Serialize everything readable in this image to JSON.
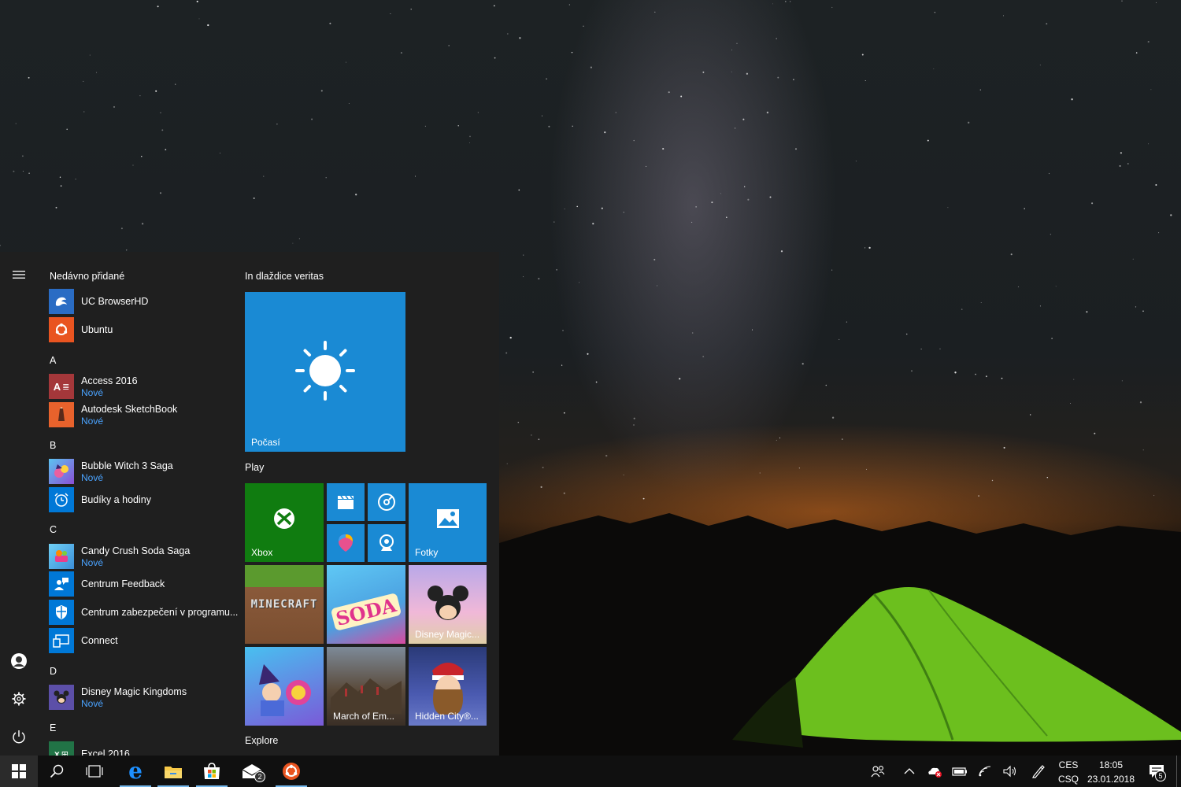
{
  "start_menu": {
    "menu_icon": "hamburger-icon",
    "recent_header": "Nedávno přidané",
    "recent": [
      {
        "name": "UC BrowserHD",
        "icon": "uc-browser-icon"
      },
      {
        "name": "Ubuntu",
        "icon": "ubuntu-icon"
      }
    ],
    "letters": {
      "a": "A",
      "b": "B",
      "c": "C",
      "d": "D",
      "e": "E"
    },
    "apps": [
      {
        "name": "Access 2016",
        "badge": "Nové",
        "icon": "access-icon"
      },
      {
        "name": "Autodesk SketchBook",
        "badge": "Nové",
        "icon": "sketchbook-icon"
      },
      {
        "name": "Bubble Witch 3 Saga",
        "badge": "Nové",
        "icon": "bubble-witch-icon"
      },
      {
        "name": "Budíky a hodiny",
        "icon": "alarm-clock-icon"
      },
      {
        "name": "Candy Crush Soda Saga",
        "badge": "Nové",
        "icon": "candy-crush-icon"
      },
      {
        "name": "Centrum Feedback",
        "icon": "feedback-icon"
      },
      {
        "name": "Centrum zabezpečení v programu...",
        "icon": "shield-icon"
      },
      {
        "name": "Connect",
        "icon": "connect-icon"
      },
      {
        "name": "Disney Magic Kingdoms",
        "badge": "Nové",
        "icon": "disney-icon"
      },
      {
        "name": "Excel 2016",
        "icon": "excel-icon"
      }
    ],
    "rail": {
      "user_icon": "user-avatar-icon",
      "settings_icon": "gear-icon",
      "power_icon": "power-icon"
    }
  },
  "tiles": {
    "groups": [
      "In dlaždice veritas",
      "Play",
      "Explore"
    ],
    "weather": {
      "label": "Počasí",
      "icon": "sun-icon"
    },
    "xbox": {
      "label": "Xbox",
      "icon": "xbox-icon"
    },
    "photos": {
      "label": "Fotky",
      "icon": "photos-icon"
    },
    "small": [
      {
        "icon": "movies-icon"
      },
      {
        "icon": "groove-music-icon"
      },
      {
        "icon": "paint3d-icon"
      },
      {
        "icon": "webcam-icon"
      }
    ],
    "games": [
      {
        "label": "",
        "art_text": "MINECRAFT",
        "icon": "minecraft-icon"
      },
      {
        "label": "",
        "art_text": "SODA",
        "icon": "candy-crush-soda-icon"
      },
      {
        "label": "Disney Magic...",
        "icon": "disney-magic-icon"
      },
      {
        "label": "",
        "icon": "bubble-witch-icon"
      },
      {
        "label": "March of Em...",
        "icon": "march-of-empires-icon"
      },
      {
        "label": "Hidden City®...",
        "icon": "hidden-city-icon"
      }
    ]
  },
  "taskbar": {
    "buttons": [
      {
        "icon": "windows-start-icon"
      },
      {
        "icon": "search-icon"
      },
      {
        "icon": "task-view-icon"
      },
      {
        "icon": "edge-icon"
      },
      {
        "icon": "file-explorer-icon"
      },
      {
        "icon": "store-icon"
      },
      {
        "icon": "mail-icon",
        "badge": "2"
      },
      {
        "icon": "ubuntu-icon"
      }
    ],
    "tray": {
      "people_icon": "people-icon",
      "chevron_icon": "chevron-up-icon",
      "icons": [
        "onedrive-error-icon",
        "battery-icon",
        "wifi-icon",
        "volume-icon",
        "pen-icon"
      ],
      "lang_top": "CES",
      "lang_bottom": "CSQ",
      "time": "18:05",
      "date": "23.01.2018",
      "notification_count": "5"
    }
  },
  "colors": {
    "accent": "#0078d7",
    "tile_blue": "#1a8ad4",
    "xbox_green": "#107c10",
    "menu_bg": "#1f1f1f",
    "taskbar_bg": "#101010",
    "new_badge": "#4aa3ff"
  }
}
